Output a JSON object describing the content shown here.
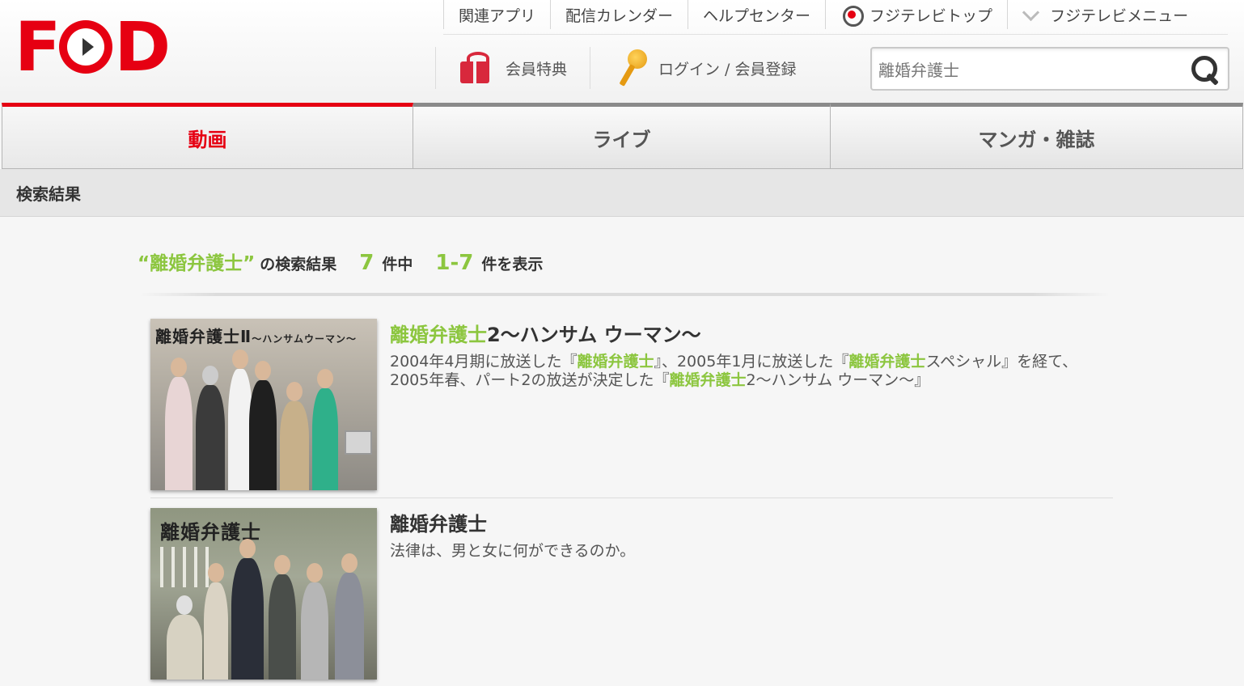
{
  "header": {
    "logo_text": "FOD",
    "top_links": [
      {
        "label": "関連アプリ"
      },
      {
        "label": "配信カレンダー"
      },
      {
        "label": "ヘルプセンター"
      },
      {
        "label": "フジテレビトップ",
        "icon": "fujitv-eye-icon"
      },
      {
        "label": "フジテレビメニュー",
        "icon": "chevron-down-icon"
      }
    ],
    "member_benefits_label": "会員特典",
    "login_label": "ログイン / 会員登録",
    "search": {
      "value": "離婚弁護士",
      "placeholder": ""
    }
  },
  "tabs": [
    {
      "label": "動画",
      "active": true
    },
    {
      "label": "ライブ",
      "active": false
    },
    {
      "label": "マンガ・雑誌",
      "active": false
    }
  ],
  "breadcrumb": "検索結果",
  "results": {
    "query_quoted": "“離婚弁護士”",
    "of_search_results": "の検索結果",
    "total": "7",
    "total_suffix": "件中",
    "range": "1-7",
    "range_suffix": "件を表示",
    "items": [
      {
        "thumb_title": "離婚弁護士Ⅱ",
        "thumb_subtitle": "〜ハンサムウーマン〜",
        "title_highlight": "離婚弁護士",
        "title_rest": "2〜ハンサム ウーマン〜",
        "desc_1": "2004年4月期に放送した『",
        "desc_hl_1": "離婚弁護士",
        "desc_2": "』、2005年1月に放送した『",
        "desc_hl_2": "離婚弁護士",
        "desc_3": "スペシャル』を経て、2005年春、パート2の放送が決定した『",
        "desc_hl_3": "離婚弁護士",
        "desc_4": "2〜ハンサム ウーマン〜』"
      },
      {
        "thumb_title": "離婚弁護士",
        "title_highlight": "離婚弁護士",
        "desc": "法律は、男と女に何ができるのか。"
      }
    ]
  },
  "colors": {
    "brand_red": "#e60012",
    "highlight_green": "#8cc63f"
  }
}
